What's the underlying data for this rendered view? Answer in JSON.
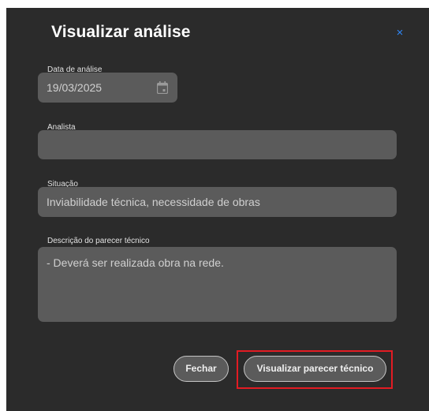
{
  "dialog": {
    "title": "Visualizar análise",
    "close_glyph": "×"
  },
  "fields": {
    "data_label": "Data de análise",
    "data_value": "19/03/2025",
    "analista_label": "Analista",
    "analista_value": "",
    "situacao_label": "Situação",
    "situacao_value": "Inviabilidade técnica, necessidade de obras",
    "descricao_label": "Descrição do parecer técnico",
    "descricao_value": "- Deverá ser realizada obra na rede."
  },
  "buttons": {
    "fechar": "Fechar",
    "visualizar_parecer": "Visualizar parecer técnico"
  },
  "icons": {
    "calendar": "calendar-icon",
    "close": "close-icon"
  },
  "colors": {
    "background": "#2b2b2b",
    "field": "#5b5b5b",
    "close_accent": "#2f86f6",
    "highlight": "#e21b23"
  }
}
